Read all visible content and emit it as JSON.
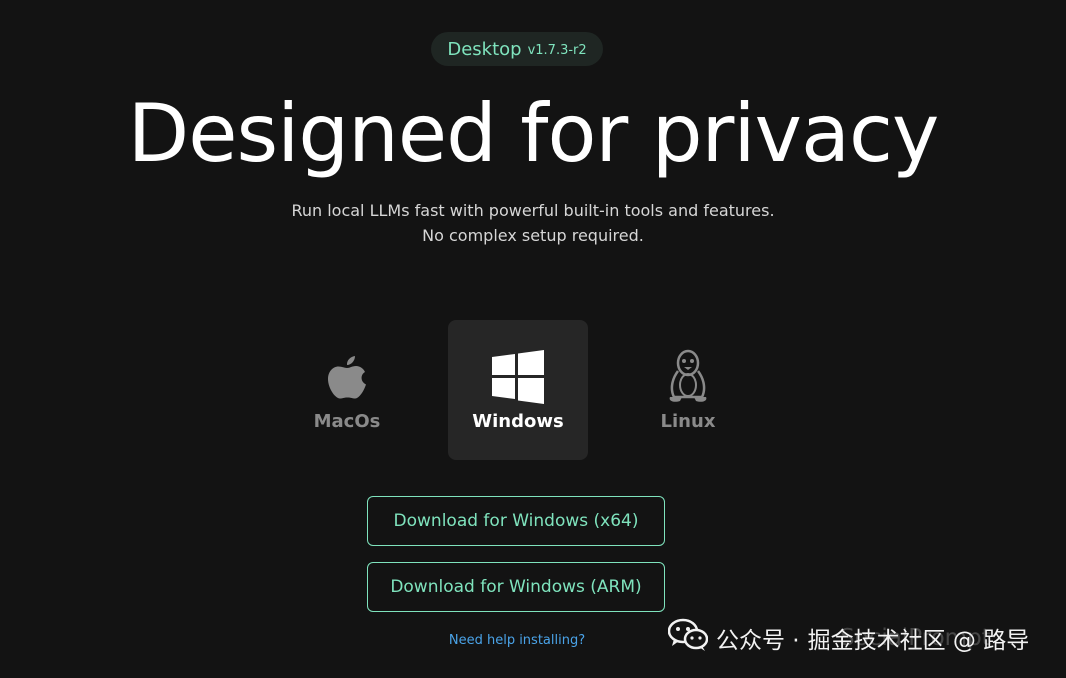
{
  "version_pill": {
    "label": "Desktop",
    "version": "v1.7.3-r2"
  },
  "hero": {
    "title": "Designed for privacy",
    "subtitle_line1": "Run local LLMs fast with powerful built-in tools and features.",
    "subtitle_line2": "No complex setup required."
  },
  "os_options": {
    "selected": "Windows",
    "items": [
      {
        "label": "MacOs",
        "icon": "apple-icon"
      },
      {
        "label": "Windows",
        "icon": "windows-icon"
      },
      {
        "label": "Linux",
        "icon": "linux-tux-icon"
      }
    ]
  },
  "downloads": {
    "x64_label": "Download for Windows (x64)",
    "arm_label": "Download for Windows (ARM)",
    "help_label": "Need help installing?"
  },
  "watermark": {
    "text_left": "公众号 ·",
    "text_main": "掘金技术社区 @ 路导",
    "ghost_text": "SocialPrompt",
    "icon": "wechat-icon"
  },
  "colors": {
    "background": "#131313",
    "accent": "#7fe3bd",
    "link": "#4aa3e8",
    "selected_card": "#262626"
  }
}
